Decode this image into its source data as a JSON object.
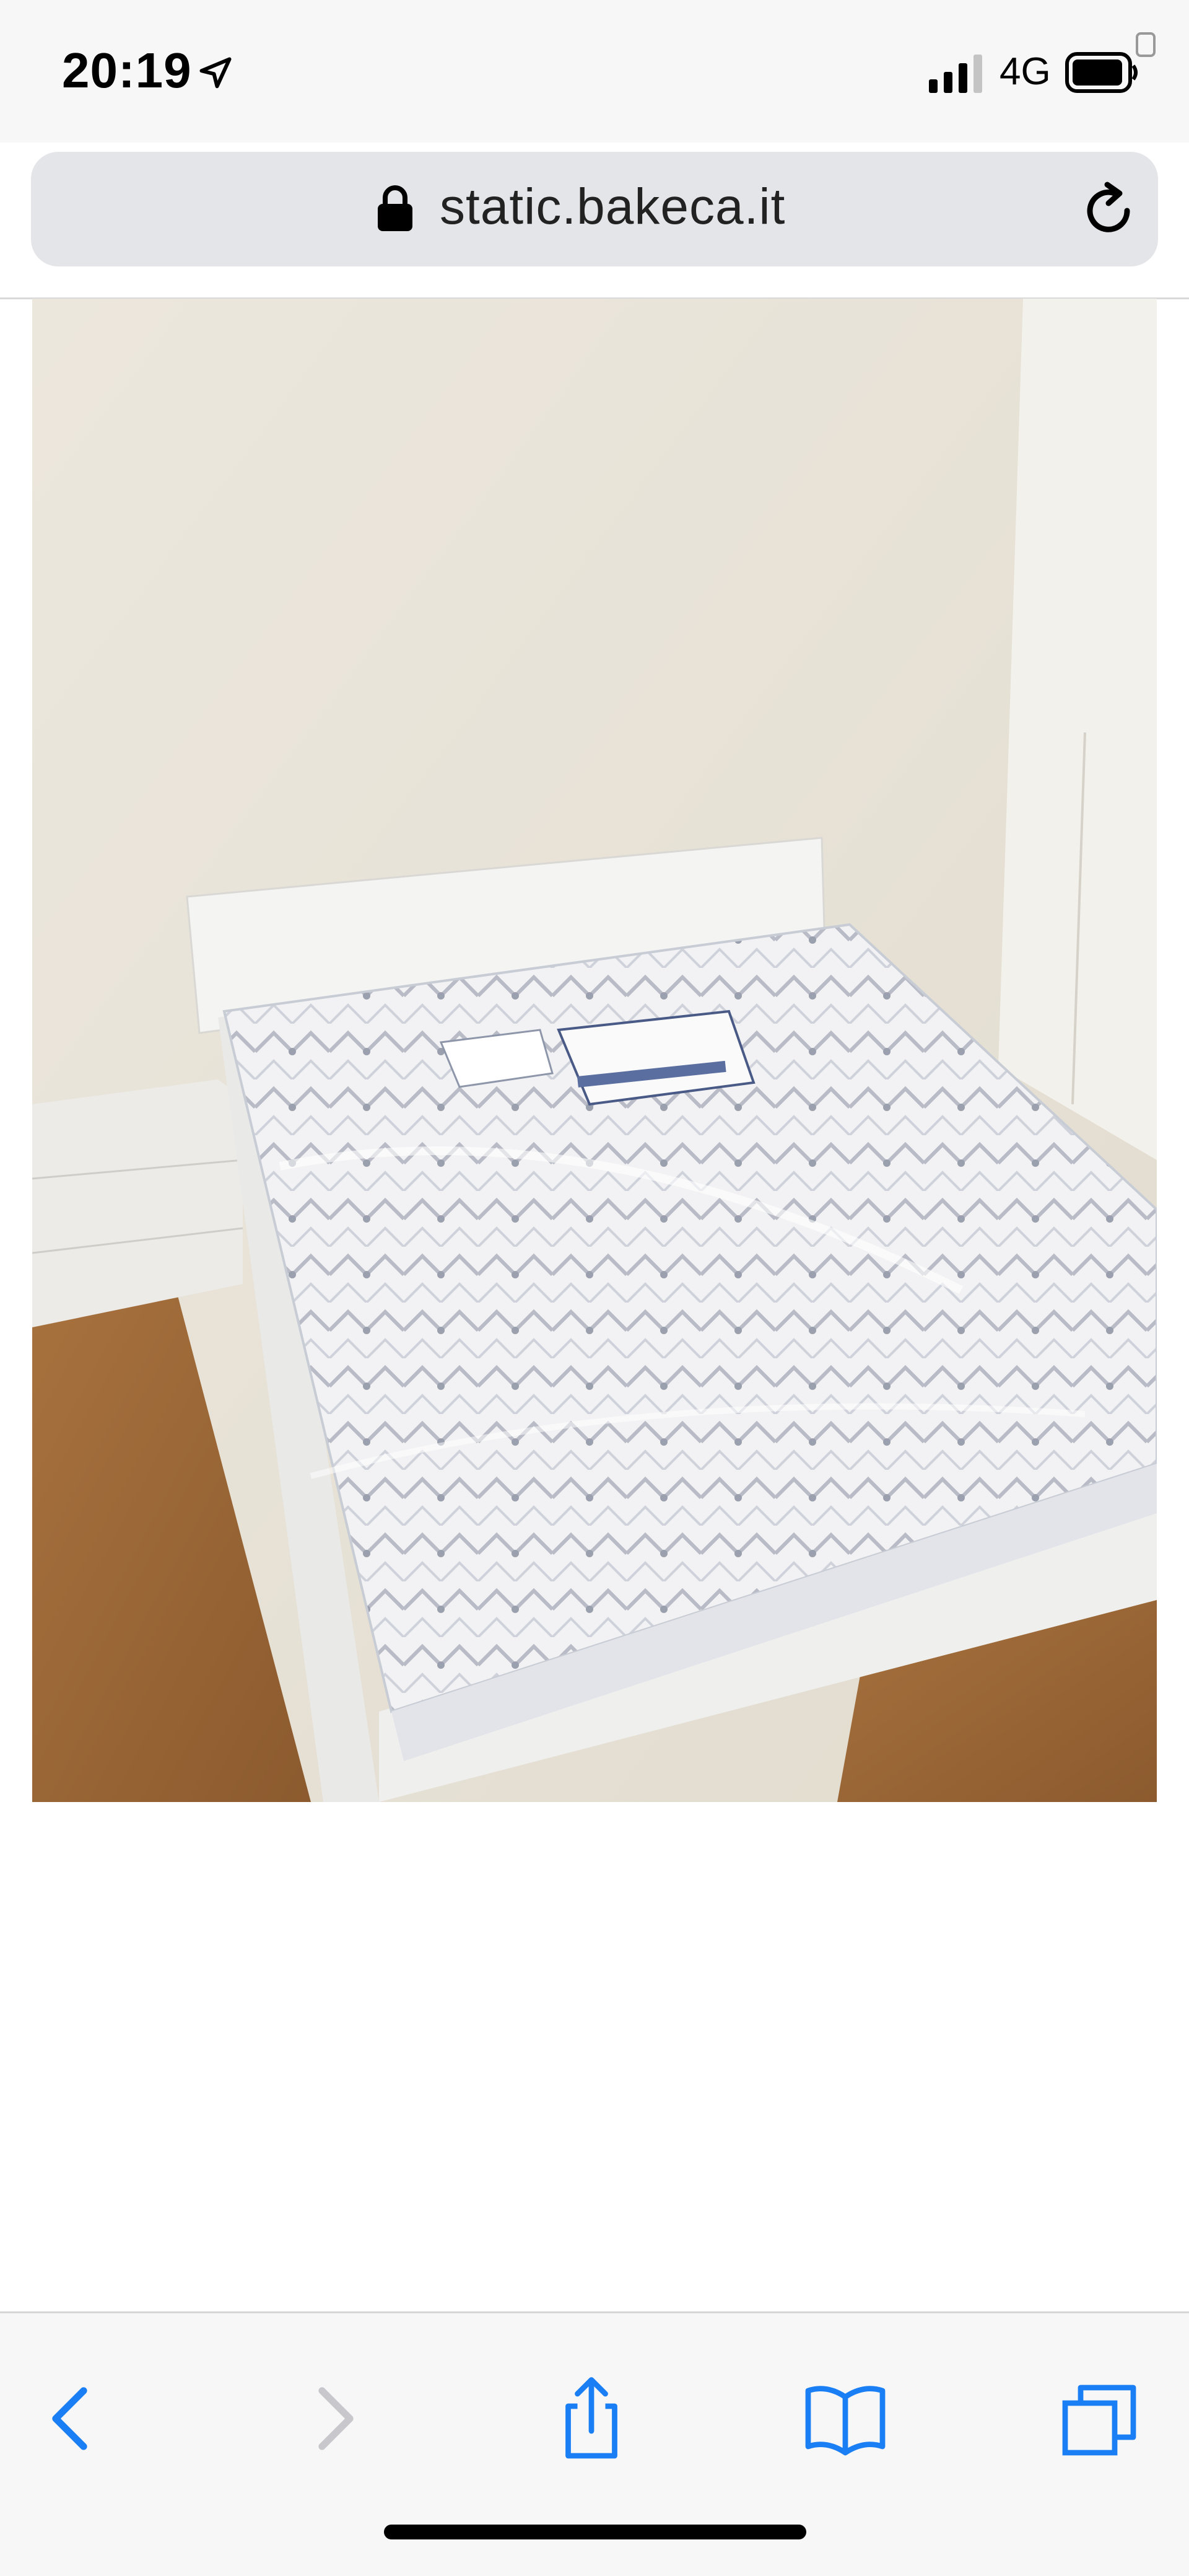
{
  "status_bar": {
    "time": "20:19",
    "network": "4G",
    "icons": [
      "location-arrow-icon",
      "signal-icon",
      "battery-icon"
    ]
  },
  "address_bar": {
    "url": "static.bakeca.it",
    "icons": [
      "lock-icon",
      "reload-icon"
    ]
  },
  "content": {
    "image_subject": "bed-with-wrapped-mattress-photo"
  },
  "toolbar": {
    "buttons": [
      "back-icon",
      "forward-icon",
      "share-icon",
      "bookmarks-icon",
      "tabs-icon"
    ],
    "forward_enabled": false
  },
  "colors": {
    "accent": "#1a7ff5",
    "disabled": "#c7c7cc",
    "bar_background": "#f7f7f7",
    "address_background": "#e4e5e8"
  }
}
